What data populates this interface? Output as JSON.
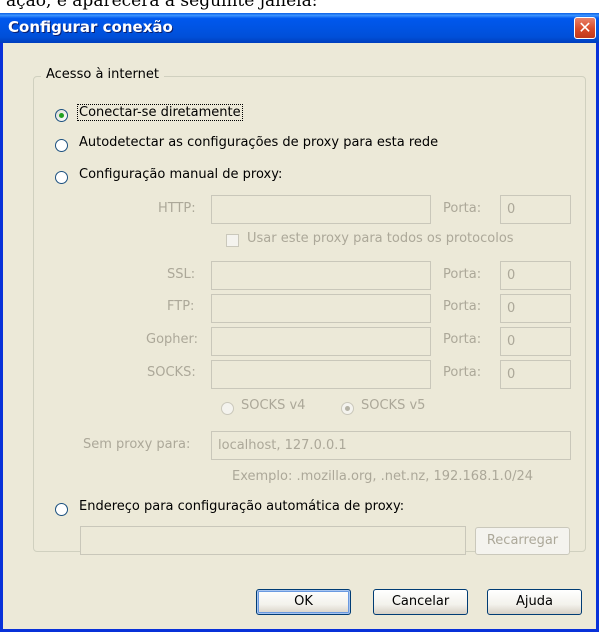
{
  "dialog": {
    "title": "Configurar conexão",
    "close_glyph": "✕"
  },
  "group": {
    "legend": "Acesso à internet"
  },
  "options": {
    "direct": "Conectar-se diretamente",
    "autodetect": "Autodetectar as configurações de proxy para esta rede",
    "manual": "Configuração manual de proxy:",
    "auto_url": "Endereço para configuração automática de proxy:",
    "selected": "direct"
  },
  "manual": {
    "http_label": "HTTP:",
    "http_value": "",
    "use_for_all_label": "Usar este proxy para todos os protocolos",
    "use_for_all_checked": false,
    "ssl_label": "SSL:",
    "ssl_value": "",
    "ftp_label": "FTP:",
    "ftp_value": "",
    "gopher_label": "Gopher:",
    "gopher_value": "",
    "socks_label": "SOCKS:",
    "socks_value": "",
    "port_label": "Porta:",
    "port_value": "0",
    "socks_v4": "SOCKS v4",
    "socks_v5": "SOCKS v5",
    "socks_version_selected": "v5",
    "no_proxy_label": "Sem proxy para:",
    "no_proxy_value": "localhost, 127.0.0.1",
    "example": "Exemplo: .mozilla.org, .net.nz, 192.168.1.0/24"
  },
  "autoconfig": {
    "url_value": "",
    "reload_label": "Recarregar"
  },
  "buttons": {
    "ok": "OK",
    "cancel": "Cancelar",
    "help": "Ajuda"
  },
  "partial_text": {
    "top_strip": "ação, é aparecerá a seguinte janela:"
  },
  "colors": {
    "titlebar": "#0054e3",
    "dialog_bg": "#ece9d8",
    "close_button": "#d84a28",
    "radio_dot": "#21a121",
    "disabled_text": "#aca899"
  }
}
